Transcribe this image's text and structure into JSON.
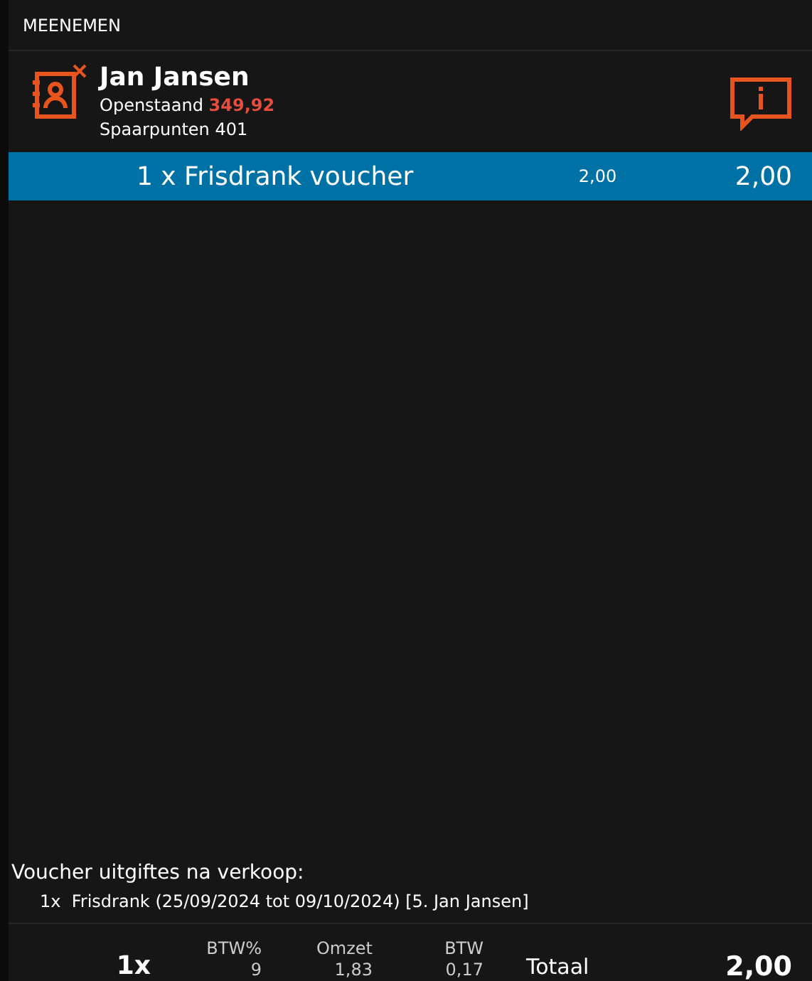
{
  "header": {
    "title": "MEENEMEN"
  },
  "customer": {
    "name": "Jan Jansen",
    "balance_label": "Openstaand",
    "balance": "349,92",
    "points": "Spaarpunten 401"
  },
  "lines": [
    {
      "text": "1 x Frisdrank voucher",
      "unit_price": "2,00",
      "amount": "2,00",
      "selected": true
    }
  ],
  "voucher_info": {
    "title": "Voucher uitgiftes na verkoop:",
    "items": [
      {
        "qty": "1x",
        "text": "Frisdrank (25/09/2024 tot 09/10/2024) [5. Jan Jansen]"
      }
    ]
  },
  "footer": {
    "count": "1x",
    "columns": [
      {
        "label": "BTW%",
        "value": "9"
      },
      {
        "label": "Omzet",
        "value": "1,83"
      },
      {
        "label": "BTW",
        "value": "0,17"
      }
    ],
    "total_label": "Totaal",
    "total": "2,00"
  }
}
